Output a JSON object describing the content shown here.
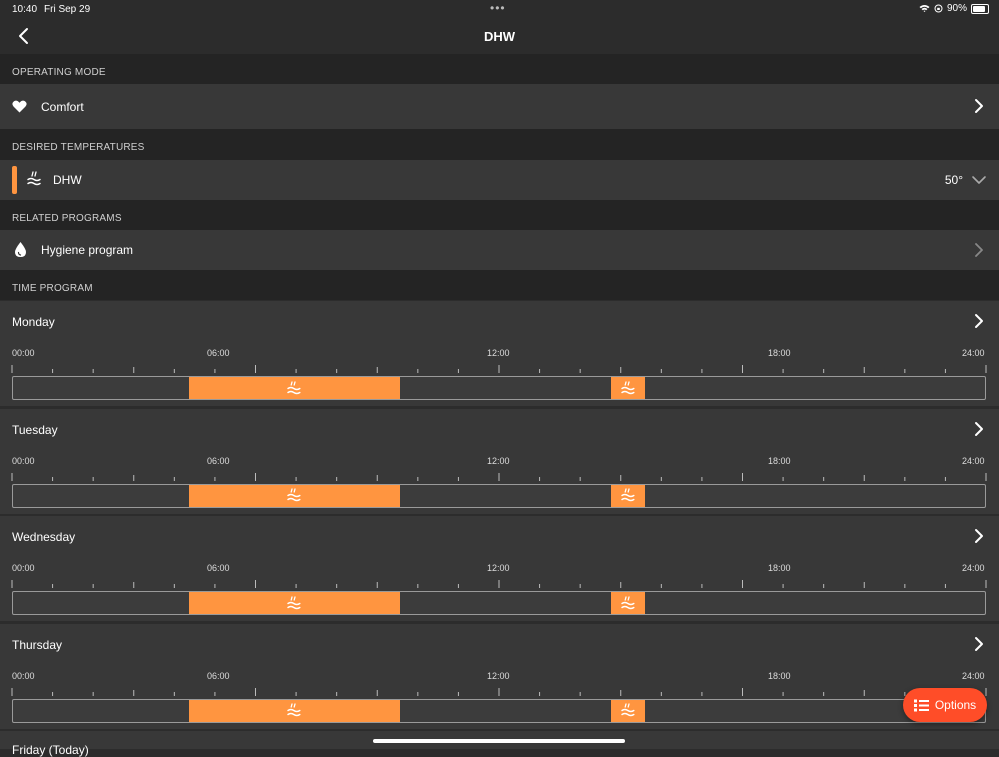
{
  "status_bar": {
    "time": "10:40",
    "date": "Fri Sep 29",
    "battery": "90%"
  },
  "nav": {
    "title": "DHW"
  },
  "operating_mode": {
    "header": "OPERATING MODE",
    "value": "Comfort"
  },
  "desired_temperatures": {
    "header": "DESIRED TEMPERATURES",
    "label": "DHW",
    "value": "50°",
    "accent": "#ff9540"
  },
  "related_programs": {
    "header": "RELATED PROGRAMS",
    "label": "Hygiene program"
  },
  "time_program": {
    "header": "TIME PROGRAM",
    "hour_labels": [
      "00:00",
      "06:00",
      "12:00",
      "18:00",
      "24:00"
    ],
    "days": [
      {
        "name": "Monday",
        "segments": [
          {
            "start": 4.35,
            "end": 9.55
          },
          {
            "start": 14.75,
            "end": 15.6
          }
        ]
      },
      {
        "name": "Tuesday",
        "segments": [
          {
            "start": 4.35,
            "end": 9.55
          },
          {
            "start": 14.75,
            "end": 15.6
          }
        ]
      },
      {
        "name": "Wednesday",
        "segments": [
          {
            "start": 4.35,
            "end": 9.55
          },
          {
            "start": 14.75,
            "end": 15.6
          }
        ]
      },
      {
        "name": "Thursday",
        "segments": [
          {
            "start": 4.35,
            "end": 9.55
          },
          {
            "start": 14.75,
            "end": 15.6
          }
        ]
      }
    ],
    "next_day_partial": "Friday (Today)"
  },
  "options_button": {
    "label": "Options"
  },
  "colors": {
    "background": "#2c2c2c",
    "row": "#383838",
    "accent": "#ff9540",
    "options": "#ff4d28"
  }
}
